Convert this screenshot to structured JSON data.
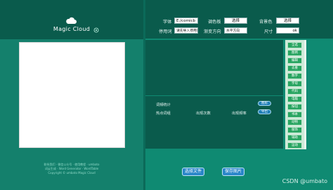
{
  "app": {
    "title": "Magic Cloud"
  },
  "controls": {
    "font_label": "字体",
    "font_value": "E:/comicb",
    "palette_label": "调色板",
    "palette_button": "选择",
    "background_label": "背景色",
    "background_button": "选择",
    "stopwords_label": "停用词",
    "stopwords_value": "请先导入停用词",
    "direction_label": "渐变方向",
    "direction_value": "水平方向",
    "size_label": "尺寸",
    "size_value": "ok"
  },
  "stats": {
    "title": "词频统计",
    "chart_button": "图形",
    "hot_words_label": "热点词组",
    "count_label": "出现次数",
    "freq_label": "出现频率",
    "export_button": "导出"
  },
  "stopword_items": [
    "全选",
    "图例",
    "编辑",
    "去重",
    "数字",
    "字母",
    "代码",
    "电脑",
    "按钮",
    "书本",
    "动物",
    "服饰",
    "辅助",
    "运动"
  ],
  "actions": {
    "select_file": "选择文件",
    "save_image": "保存图片"
  },
  "footer": {
    "line1": "联系我们 · 微信公众号 · 使用教程 · umbato",
    "line2": "词云生成 · Word Generator · WordTable",
    "line3": "Copyright © umbato Magic Cloud"
  },
  "watermark": "CSDN @umbato",
  "colors": {
    "bg": "#0f8a72",
    "panel_dark": "#0a5b4c",
    "green_btn": "#29a561",
    "blue_btn": "#2a86c9"
  }
}
